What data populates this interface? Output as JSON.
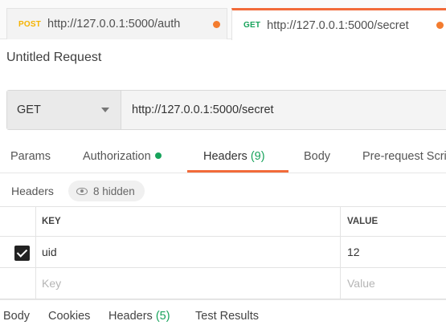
{
  "tabs": [
    {
      "method": "POST",
      "url": "http://127.0.0.1:5000/auth"
    },
    {
      "method": "GET",
      "url": "http://127.0.0.1:5000/secret"
    }
  ],
  "request": {
    "title": "Untitled Request",
    "method": "GET",
    "url": "http://127.0.0.1:5000/secret"
  },
  "request_tabs": {
    "params": "Params",
    "authorization": "Authorization",
    "headers": "Headers",
    "headers_count": "(9)",
    "body": "Body",
    "prerequest": "Pre-request Script"
  },
  "headers_section": {
    "label": "Headers",
    "hidden": "8 hidden"
  },
  "table": {
    "key_header": "KEY",
    "value_header": "VALUE",
    "rows": [
      {
        "key": "uid",
        "value": "12",
        "checked": true
      }
    ],
    "key_placeholder": "Key",
    "value_placeholder": "Value"
  },
  "response_tabs": {
    "body": "Body",
    "cookies": "Cookies",
    "headers": "Headers",
    "headers_count": "(5)",
    "test_results": "Test Results"
  },
  "colors": {
    "accent": "#f26b3a",
    "green": "#17a35b",
    "post": "#f5b300"
  }
}
